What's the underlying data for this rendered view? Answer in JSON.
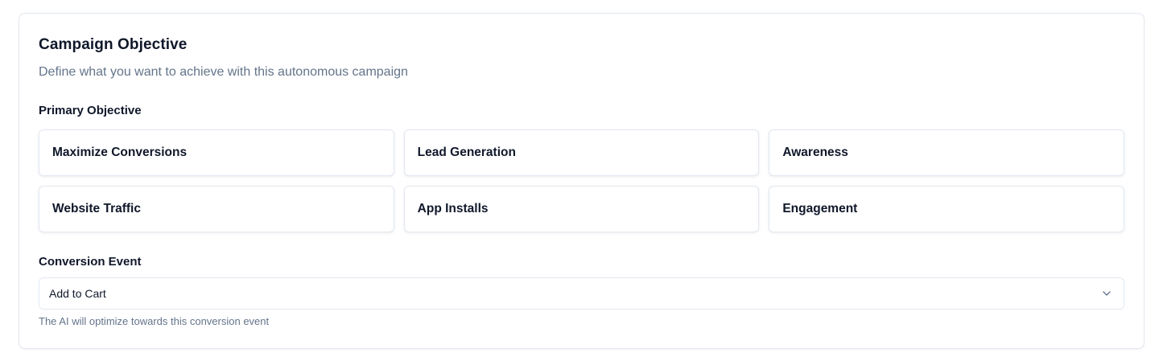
{
  "card": {
    "title": "Campaign Objective",
    "subtitle": "Define what you want to achieve with this autonomous campaign"
  },
  "primary_objective": {
    "label": "Primary Objective",
    "options": [
      {
        "label": "Maximize Conversions"
      },
      {
        "label": "Lead Generation"
      },
      {
        "label": "Awareness"
      },
      {
        "label": "Website Traffic"
      },
      {
        "label": "App Installs"
      },
      {
        "label": "Engagement"
      }
    ]
  },
  "conversion_event": {
    "label": "Conversion Event",
    "selected_value": "Add to Cart",
    "help_text": "The AI will optimize towards this conversion event",
    "icon": "chevron-down-icon"
  },
  "colors": {
    "text_primary": "#0f172a",
    "text_muted": "#64748b",
    "border": "#e2e8f0",
    "background": "#ffffff"
  }
}
